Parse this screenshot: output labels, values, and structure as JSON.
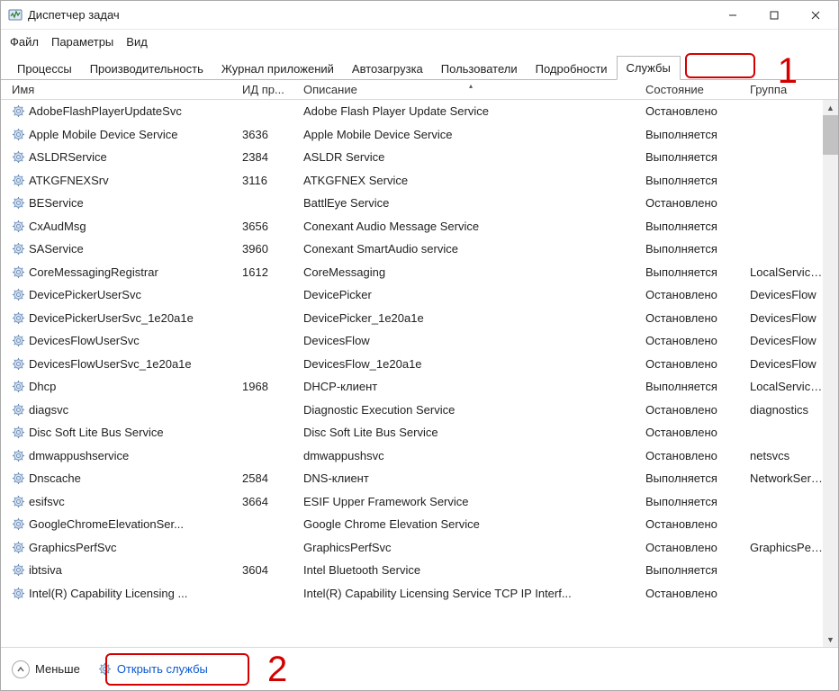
{
  "window": {
    "title": "Диспетчер задач"
  },
  "menu": {
    "file": "Файл",
    "options": "Параметры",
    "view": "Вид"
  },
  "tabs": {
    "processes": "Процессы",
    "performance": "Производительность",
    "app_history": "Журнал приложений",
    "startup": "Автозагрузка",
    "users": "Пользователи",
    "details": "Подробности",
    "services": "Службы"
  },
  "columns": {
    "name": "Имя",
    "pid": "ИД пр...",
    "desc": "Описание",
    "state": "Состояние",
    "group": "Группа"
  },
  "states": {
    "stopped": "Остановлено",
    "running": "Выполняется"
  },
  "rows": [
    {
      "name": "AdobeFlashPlayerUpdateSvc",
      "pid": "",
      "desc": "Adobe Flash Player Update Service",
      "state": "Остановлено",
      "group": ""
    },
    {
      "name": "Apple Mobile Device Service",
      "pid": "3636",
      "desc": "Apple Mobile Device Service",
      "state": "Выполняется",
      "group": ""
    },
    {
      "name": "ASLDRService",
      "pid": "2384",
      "desc": "ASLDR Service",
      "state": "Выполняется",
      "group": ""
    },
    {
      "name": "ATKGFNEXSrv",
      "pid": "3116",
      "desc": "ATKGFNEX Service",
      "state": "Выполняется",
      "group": ""
    },
    {
      "name": "BEService",
      "pid": "",
      "desc": "BattlEye Service",
      "state": "Остановлено",
      "group": ""
    },
    {
      "name": "CxAudMsg",
      "pid": "3656",
      "desc": "Conexant Audio Message Service",
      "state": "Выполняется",
      "group": ""
    },
    {
      "name": "SAService",
      "pid": "3960",
      "desc": "Conexant SmartAudio service",
      "state": "Выполняется",
      "group": ""
    },
    {
      "name": "CoreMessagingRegistrar",
      "pid": "1612",
      "desc": "CoreMessaging",
      "state": "Выполняется",
      "group": "LocalServiceNo..."
    },
    {
      "name": "DevicePickerUserSvc",
      "pid": "",
      "desc": "DevicePicker",
      "state": "Остановлено",
      "group": "DevicesFlow"
    },
    {
      "name": "DevicePickerUserSvc_1e20a1e",
      "pid": "",
      "desc": "DevicePicker_1e20a1e",
      "state": "Остановлено",
      "group": "DevicesFlow"
    },
    {
      "name": "DevicesFlowUserSvc",
      "pid": "",
      "desc": "DevicesFlow",
      "state": "Остановлено",
      "group": "DevicesFlow"
    },
    {
      "name": "DevicesFlowUserSvc_1e20a1e",
      "pid": "",
      "desc": "DevicesFlow_1e20a1e",
      "state": "Остановлено",
      "group": "DevicesFlow"
    },
    {
      "name": "Dhcp",
      "pid": "1968",
      "desc": "DHCP-клиент",
      "state": "Выполняется",
      "group": "LocalServiceNet..."
    },
    {
      "name": "diagsvc",
      "pid": "",
      "desc": "Diagnostic Execution Service",
      "state": "Остановлено",
      "group": "diagnostics"
    },
    {
      "name": "Disc Soft Lite Bus Service",
      "pid": "",
      "desc": "Disc Soft Lite Bus Service",
      "state": "Остановлено",
      "group": ""
    },
    {
      "name": "dmwappushservice",
      "pid": "",
      "desc": "dmwappushsvc",
      "state": "Остановлено",
      "group": "netsvcs"
    },
    {
      "name": "Dnscache",
      "pid": "2584",
      "desc": "DNS-клиент",
      "state": "Выполняется",
      "group": "NetworkService"
    },
    {
      "name": "esifsvc",
      "pid": "3664",
      "desc": "ESIF Upper Framework Service",
      "state": "Выполняется",
      "group": ""
    },
    {
      "name": "GoogleChromeElevationSer...",
      "pid": "",
      "desc": "Google Chrome Elevation Service",
      "state": "Остановлено",
      "group": ""
    },
    {
      "name": "GraphicsPerfSvc",
      "pid": "",
      "desc": "GraphicsPerfSvc",
      "state": "Остановлено",
      "group": "GraphicsPerfSv..."
    },
    {
      "name": "ibtsiva",
      "pid": "3604",
      "desc": "Intel Bluetooth Service",
      "state": "Выполняется",
      "group": ""
    },
    {
      "name": "Intel(R) Capability Licensing ...",
      "pid": "",
      "desc": "Intel(R) Capability Licensing Service TCP IP Interf...",
      "state": "Остановлено",
      "group": ""
    }
  ],
  "footer": {
    "fewer": "Меньше",
    "open_services": "Открыть службы"
  },
  "annotations": {
    "one": "1",
    "two": "2"
  }
}
